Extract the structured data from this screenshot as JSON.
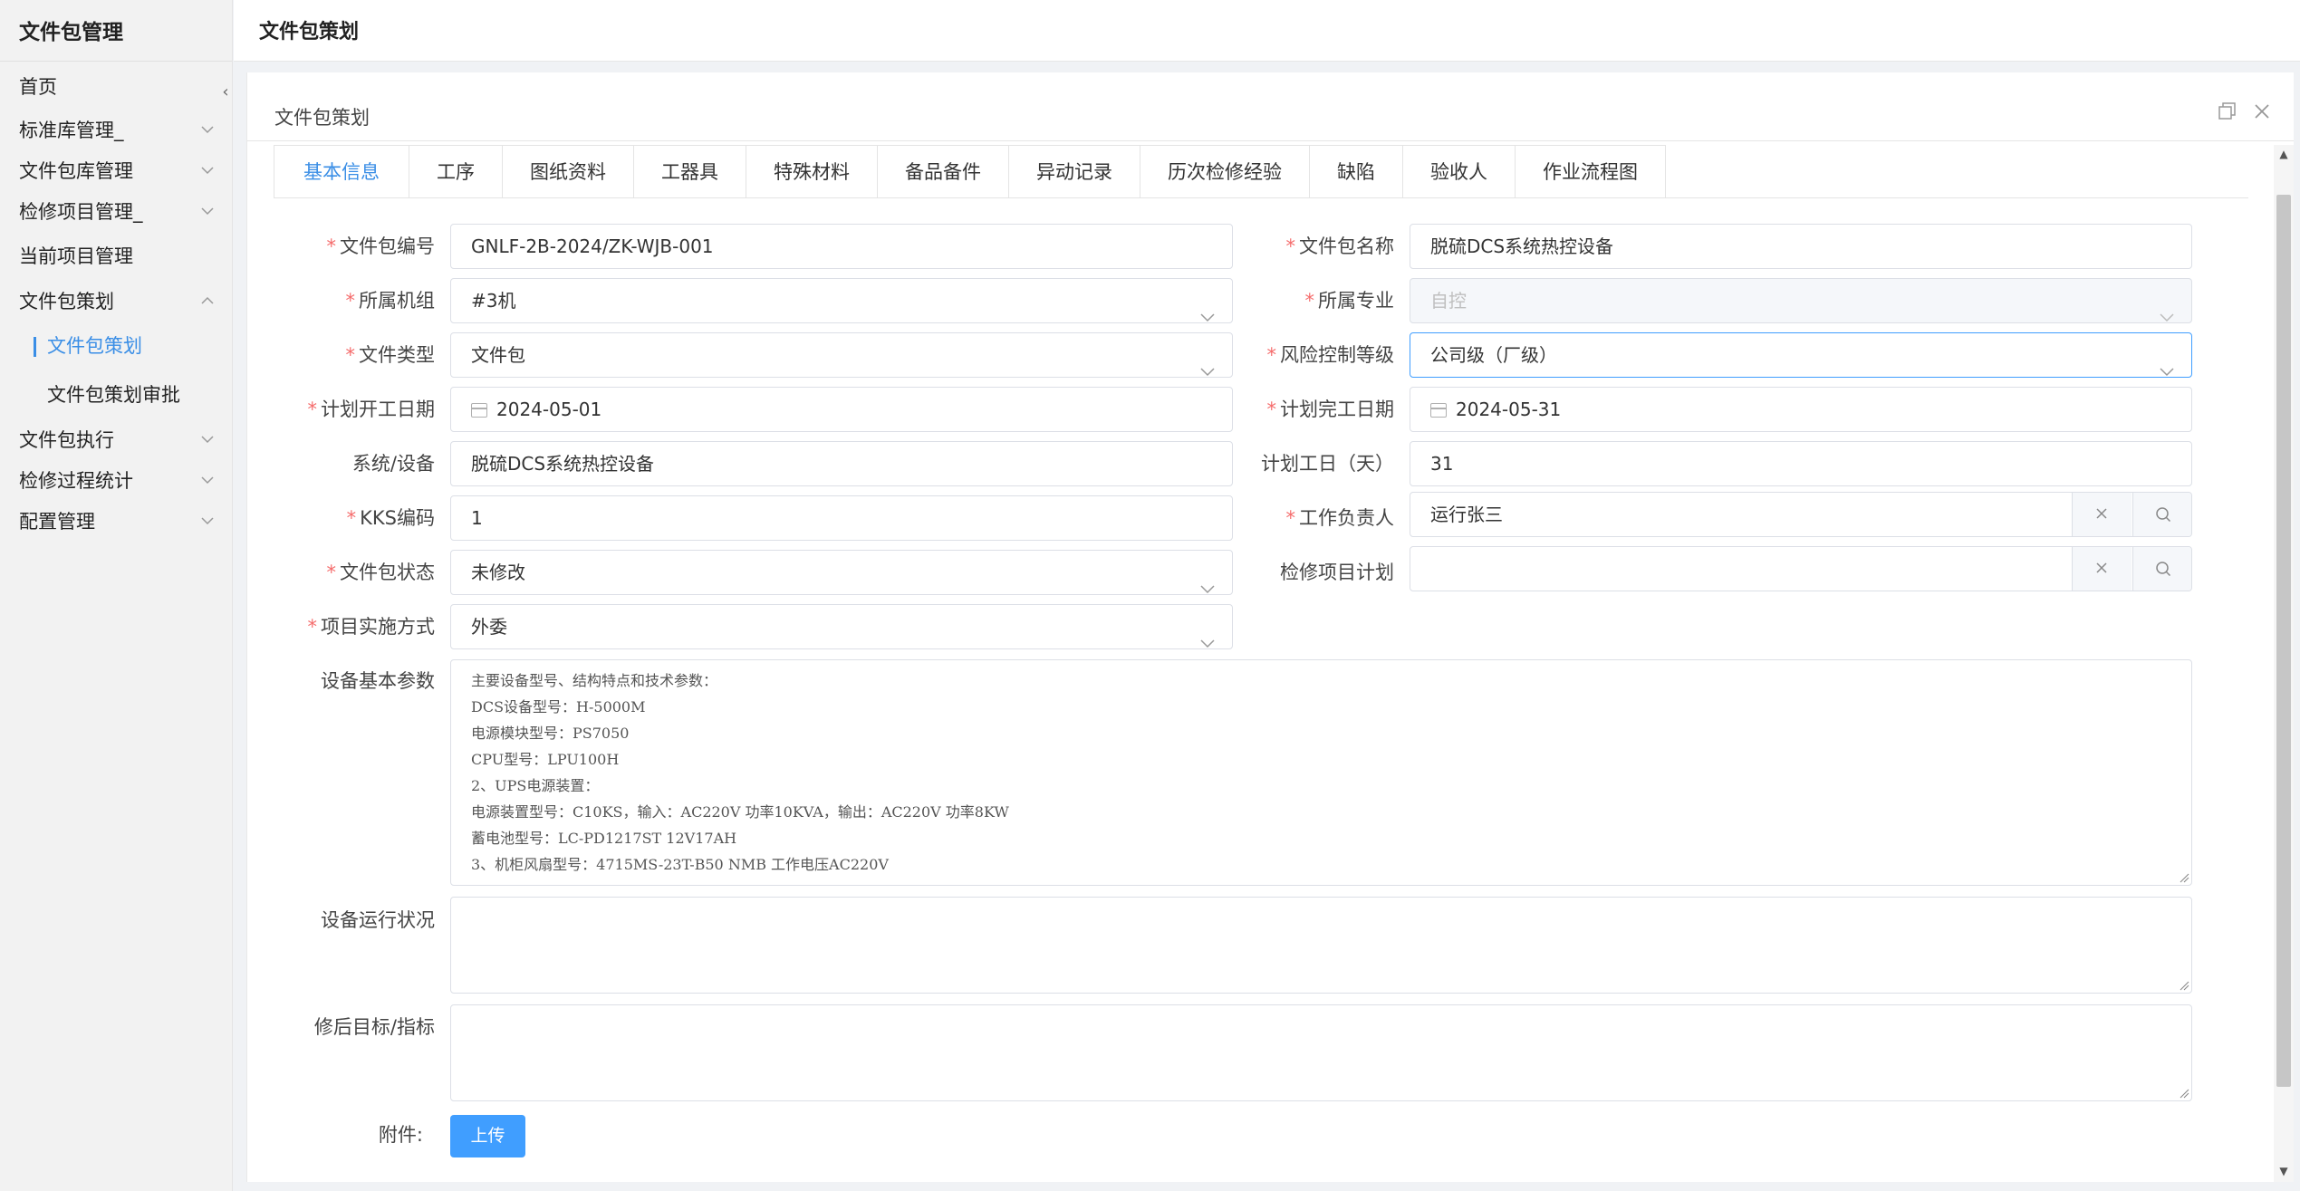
{
  "sidebar": {
    "brand": "文件包管理",
    "items": [
      {
        "label": "首页"
      },
      {
        "label": "标准库管理_"
      },
      {
        "label": "文件包库管理"
      },
      {
        "label": "检修项目管理_"
      },
      {
        "label": "当前项目管理"
      },
      {
        "label": "文件包策划"
      },
      {
        "label": "文件包策划"
      },
      {
        "label": "文件包策划审批"
      },
      {
        "label": "文件包执行"
      },
      {
        "label": "检修过程统计"
      },
      {
        "label": "配置管理"
      }
    ]
  },
  "header": {
    "title": "文件包策划"
  },
  "dialog": {
    "title": "文件包策划"
  },
  "tabs": [
    {
      "label": "基本信息"
    },
    {
      "label": "工序"
    },
    {
      "label": "图纸资料"
    },
    {
      "label": "工器具"
    },
    {
      "label": "特殊材料"
    },
    {
      "label": "备品备件"
    },
    {
      "label": "异动记录"
    },
    {
      "label": "历次检修经验"
    },
    {
      "label": "缺陷"
    },
    {
      "label": "验收人"
    },
    {
      "label": "作业流程图"
    }
  ],
  "form": {
    "package_no": {
      "label": "文件包编号",
      "value": "GNLF-2B-2024/ZK-WJB-001"
    },
    "package_name": {
      "label": "文件包名称",
      "value": "脱硫DCS系统热控设备"
    },
    "unit": {
      "label": "所属机组",
      "value": "#3机"
    },
    "specialty": {
      "label": "所属专业",
      "value": "自控"
    },
    "file_type": {
      "label": "文件类型",
      "value": "文件包"
    },
    "risk_level": {
      "label": "风险控制等级",
      "value": "公司级（厂级）"
    },
    "plan_start": {
      "label": "计划开工日期",
      "value": "2024-05-01"
    },
    "plan_end": {
      "label": "计划完工日期",
      "value": "2024-05-31"
    },
    "system": {
      "label": "系统/设备",
      "value": "脱硫DCS系统热控设备"
    },
    "work_days": {
      "label": "计划工日（天）",
      "value": "31"
    },
    "kks": {
      "label": "KKS编码",
      "value": "1"
    },
    "leader": {
      "label": "工作负责人",
      "value": "运行张三"
    },
    "status": {
      "label": "文件包状态",
      "value": "未修改"
    },
    "plan": {
      "label": "检修项目计划",
      "value": ""
    },
    "impl": {
      "label": "项目实施方式",
      "value": "外委"
    },
    "params": {
      "label": "设备基本参数",
      "lines": [
        "主要设备型号、结构特点和技术参数：",
        "DCS设备型号：H-5000M",
        "电源模块型号：PS7050",
        "CPU型号：LPU100H",
        "2、UPS电源装置：",
        "电源装置型号：C10KS，输入：AC220V 功率10KVA，输出：AC220V 功率8KW",
        "蓄电池型号：LC-PD1217ST 12V17AH",
        "3、机柜风扇型号：4715MS-23T-B50 NMB 工作电压AC220V"
      ]
    },
    "running": {
      "label": "设备运行状况"
    },
    "target": {
      "label": "修后目标/指标"
    },
    "attachment": {
      "label": "附件:",
      "button": "上传"
    }
  }
}
